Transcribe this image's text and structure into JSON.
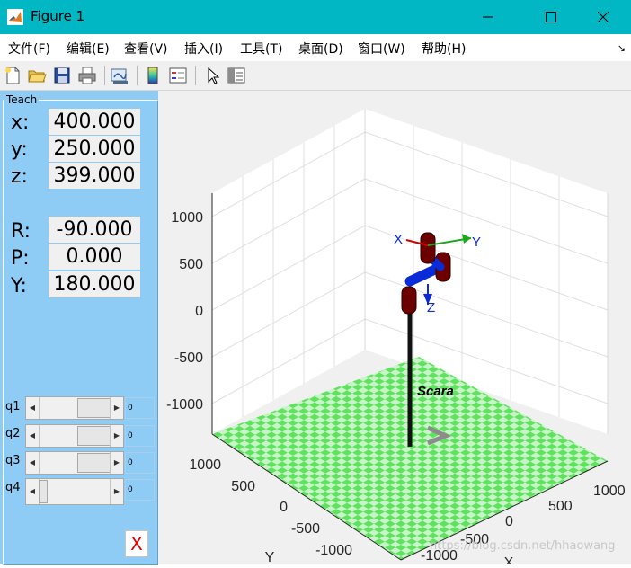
{
  "window": {
    "title": "Figure 1",
    "controls": {
      "minimize": "minimize-icon",
      "maximize": "maximize-icon",
      "close": "close-icon"
    }
  },
  "menu": {
    "items": [
      "文件(F)",
      "编辑(E)",
      "查看(V)",
      "插入(I)",
      "工具(T)",
      "桌面(D)",
      "窗口(W)",
      "帮助(H)"
    ]
  },
  "toolbar": {
    "icons": [
      "new-figure-icon",
      "open-file-icon",
      "save-icon",
      "print-icon",
      "link-plot-icon",
      "colorbar-icon",
      "legend-icon",
      "pointer-icon",
      "property-inspector-icon"
    ]
  },
  "teach": {
    "title": "Teach",
    "position": [
      {
        "label": "x:",
        "value": "400.000"
      },
      {
        "label": "y:",
        "value": "250.000"
      },
      {
        "label": "z:",
        "value": "399.000"
      }
    ],
    "orientation": [
      {
        "label": "R:",
        "value": "-90.000"
      },
      {
        "label": "P:",
        "value": "0.000"
      },
      {
        "label": "Y:",
        "value": "180.000"
      }
    ],
    "joints": [
      {
        "label": "q1",
        "value": "0"
      },
      {
        "label": "q2",
        "value": "0"
      },
      {
        "label": "q3",
        "value": "0"
      },
      {
        "label": "q4",
        "value": "0"
      }
    ],
    "close_label": "X"
  },
  "plot": {
    "robot_name": "Scara",
    "z_ticks": [
      "1000",
      "500",
      "0",
      "-500",
      "-1000"
    ],
    "y_ticks": [
      "1000",
      "500",
      "0",
      "-500",
      "-1000"
    ],
    "x_ticks": [
      "1000",
      "500",
      "0",
      "-500",
      "-1000"
    ],
    "y_axis_label": "Y",
    "x_axis_label": "X",
    "frame_labels": {
      "x": "X",
      "y": "Y",
      "z": "Z"
    },
    "floor_colors": {
      "light": "#c8f5c8",
      "dark": "#5fe35f"
    },
    "link_color": "#0a2bd8",
    "joint_color": "#6b0000"
  },
  "watermark": "https://blog.csdn.net/hhaowang",
  "colors": {
    "titlebar": "#00b7c3",
    "panel": "#8ecbf5",
    "plot_bg": "#f0f0f0"
  }
}
